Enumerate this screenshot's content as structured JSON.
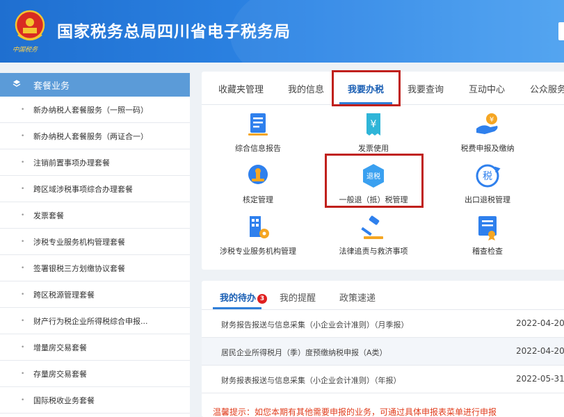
{
  "header": {
    "title": "国家税务总局四川省电子税务局",
    "emblem_caption": "中国税务"
  },
  "sidebar": {
    "title": "套餐业务",
    "items": [
      "新办纳税人套餐服务（一照一码）",
      "新办纳税人套餐服务（两证合一）",
      "注销前置事项办理套餐",
      "跨区域涉税事项综合办理套餐",
      "发票套餐",
      "涉税专业服务机构管理套餐",
      "签署银税三方划缴协议套餐",
      "跨区税源管理套餐",
      "财产行为税企业所得税综合申报...",
      "增量房交易套餐",
      "存量房交易套餐",
      "国际税收业务套餐"
    ]
  },
  "tabs": [
    "收藏夹管理",
    "我的信息",
    "我要办税",
    "我要查询",
    "互动中心",
    "公众服务"
  ],
  "services": [
    {
      "label": "综合信息报告",
      "icon": "report-icon"
    },
    {
      "label": "发票使用",
      "icon": "invoice-icon"
    },
    {
      "label": "税费申报及缴纳",
      "icon": "tax-payment-icon"
    },
    {
      "label": "核定管理",
      "icon": "stamp-icon"
    },
    {
      "label": "一般退（抵）税管理",
      "icon": "tax-refund-icon",
      "icon_text": "退税"
    },
    {
      "label": "出口退税管理",
      "icon": "export-refund-icon",
      "icon_text": "税"
    },
    {
      "label": "涉税专业服务机构管理",
      "icon": "building-gear-icon"
    },
    {
      "label": "法律追责与救济事项",
      "icon": "gavel-icon"
    },
    {
      "label": "稽查检查",
      "icon": "inspection-icon"
    }
  ],
  "todo": {
    "tabs": [
      "我的待办",
      "我的提醒",
      "政策速递"
    ],
    "badge": "3",
    "rows": [
      {
        "title": "财务报告报送与信息采集（小企业会计准则）（月季报）",
        "date": "2022-04-20"
      },
      {
        "title": "居民企业所得税月（季）度预缴纳税申报（A类）",
        "date": "2022-04-20"
      },
      {
        "title": "财务报表报送与信息采集（小企业会计准则）（年报）",
        "date": "2022-05-31"
      }
    ],
    "tip": "温馨提示：如您本期有其他需要申报的业务，可通过具体申报表菜单进行申报"
  },
  "colors": {
    "header_blue": "#2e86e6",
    "sidebar_head": "#5b9bd8",
    "highlight_red": "#c0201c",
    "tip_red": "#e03c1c"
  }
}
